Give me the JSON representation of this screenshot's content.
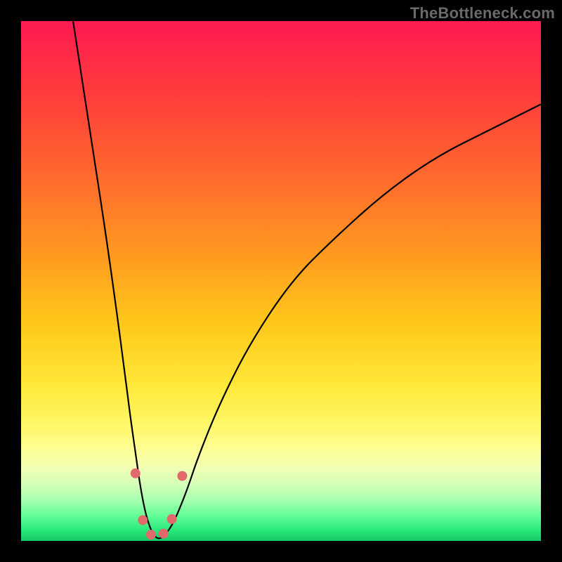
{
  "watermark": "TheBottleneck.com",
  "colors": {
    "frame": "#000000",
    "curve": "#000000",
    "dot": "#e06a6b",
    "gradient_top": "#ff1a52",
    "gradient_bottom": "#14c864"
  },
  "chart_data": {
    "type": "line",
    "title": "",
    "xlabel": "",
    "ylabel": "",
    "xlim": [
      0,
      100
    ],
    "ylim": [
      0,
      100
    ],
    "series": [
      {
        "name": "curve",
        "x": [
          10,
          12,
          14,
          16,
          18,
          20,
          21,
          22,
          23,
          24,
          25,
          26,
          27,
          28,
          29,
          30,
          32,
          34,
          38,
          44,
          52,
          60,
          70,
          80,
          90,
          100
        ],
        "values": [
          100,
          87,
          74,
          61,
          47,
          32,
          24,
          17,
          10,
          5,
          2,
          0.5,
          0.5,
          1.5,
          3,
          5,
          10,
          16,
          26,
          38,
          50,
          58,
          67,
          74,
          79,
          84
        ]
      }
    ],
    "markers": [
      {
        "x": 22.0,
        "y": 13.0
      },
      {
        "x": 23.4,
        "y": 4.0
      },
      {
        "x": 25.0,
        "y": 1.2
      },
      {
        "x": 27.4,
        "y": 1.4
      },
      {
        "x": 29.0,
        "y": 4.2
      },
      {
        "x": 31.0,
        "y": 12.5
      }
    ],
    "annotations": []
  }
}
